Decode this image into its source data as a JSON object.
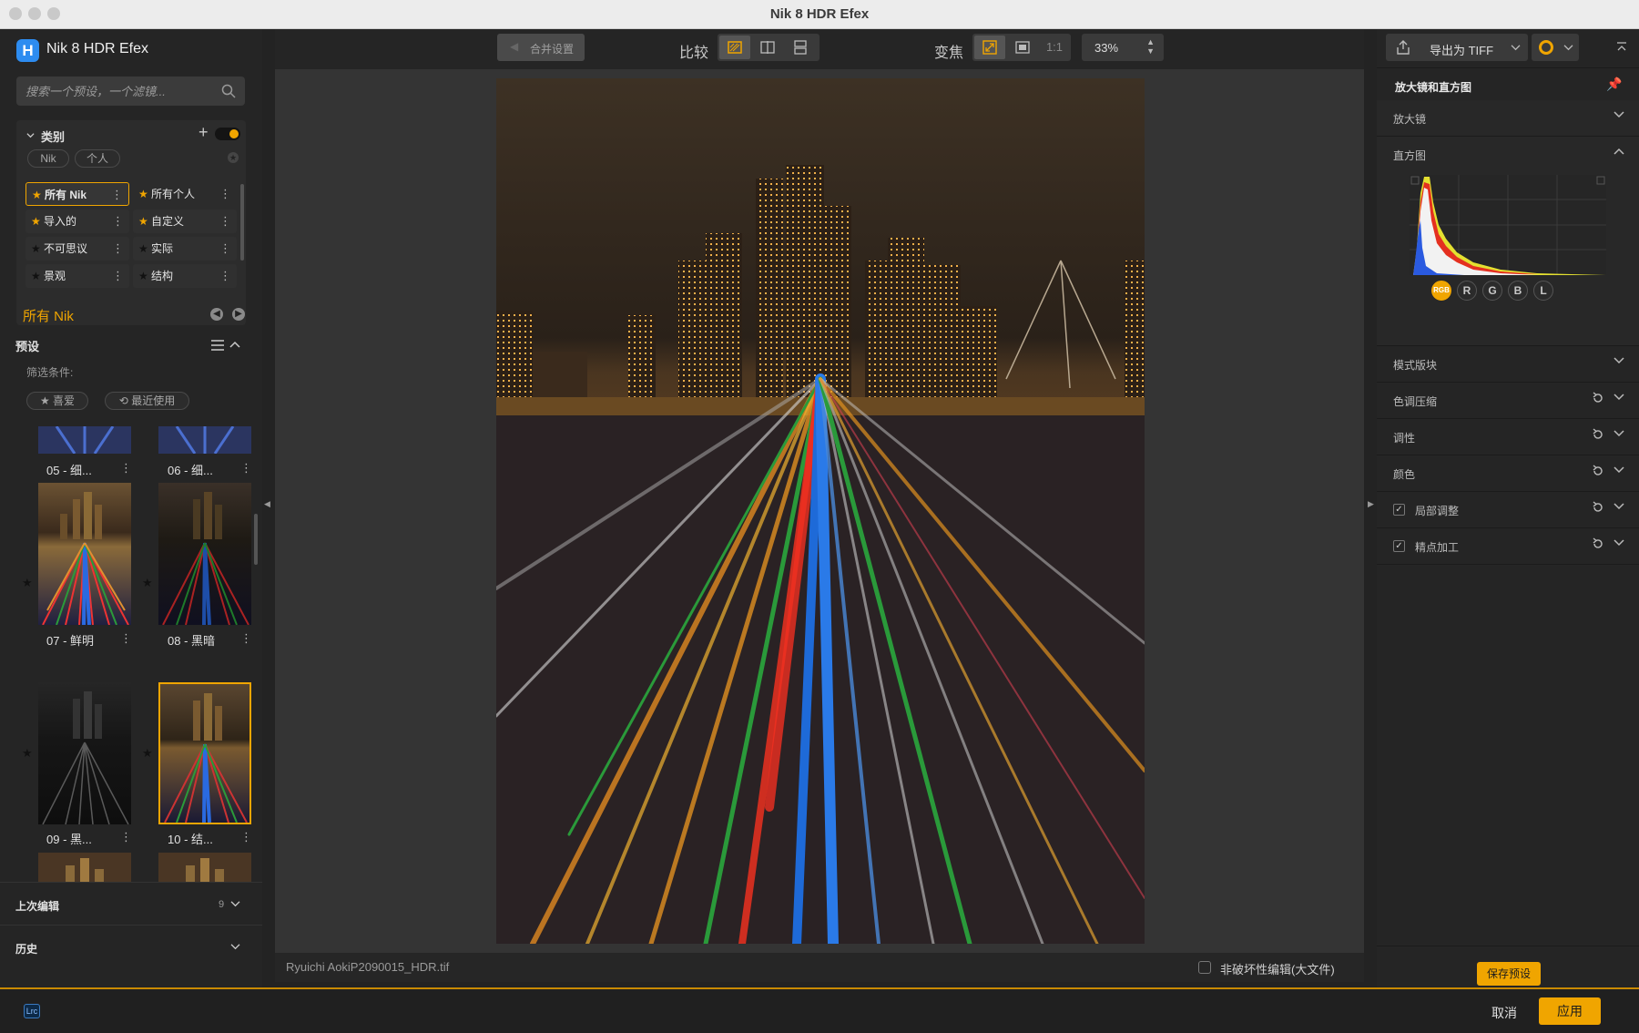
{
  "window": {
    "title": "Nik 8 HDR Efex"
  },
  "sidebar": {
    "app_name": "Nik 8 HDR Efex",
    "logo_letter": "H",
    "search_placeholder": "搜索一个预设，一个滤镜...",
    "category_title": "类别",
    "filter_pills": [
      "Nik",
      "个人"
    ],
    "categories": [
      {
        "label": "所有 Nik",
        "starred": true,
        "selected": true
      },
      {
        "label": "所有个人",
        "starred": true,
        "selected": false
      },
      {
        "label": "导入的",
        "starred": true,
        "selected": false
      },
      {
        "label": "自定义",
        "starred": true,
        "selected": false
      },
      {
        "label": "不可思议",
        "starred": false,
        "selected": false
      },
      {
        "label": "实际",
        "starred": false,
        "selected": false
      },
      {
        "label": "景观",
        "starred": false,
        "selected": false
      },
      {
        "label": "结构",
        "starred": false,
        "selected": false
      }
    ],
    "current_collection": "所有 Nik",
    "presets_title": "预设",
    "filter_conditions": "筛选条件:",
    "filter_buttons": [
      "喜爱",
      "最近使用"
    ],
    "presets": [
      {
        "label": "05 - 细..."
      },
      {
        "label": "06 - 细..."
      },
      {
        "label": "07 - 鲜明"
      },
      {
        "label": "08 - 黑暗"
      },
      {
        "label": "09 - 黑..."
      },
      {
        "label": "10 - 结..."
      }
    ],
    "last_edit": {
      "label": "上次编辑",
      "count": "9"
    },
    "history": "历史"
  },
  "toolbar": {
    "merge_label": "合并设置",
    "compare_label": "比较",
    "zoom_label": "变焦",
    "one_to_one": "1:1",
    "zoom_value": "33%"
  },
  "status": {
    "filename": "Ryuichi AokiP2090015_HDR.tif",
    "nondestructive": "非破坏性编辑(大文件)"
  },
  "right_panel": {
    "export_label": "导出为 TIFF",
    "loupe_title": "放大镜和直方图",
    "loupe": "放大镜",
    "histogram": "直方图",
    "channels": [
      "RGB",
      "R",
      "G",
      "B",
      "L"
    ],
    "sections": [
      {
        "label": "模式版块",
        "reset": false,
        "checkbox": false
      },
      {
        "label": "色调压缩",
        "reset": true,
        "checkbox": false
      },
      {
        "label": "调性",
        "reset": true,
        "checkbox": false
      },
      {
        "label": "颜色",
        "reset": true,
        "checkbox": false
      },
      {
        "label": "局部调整",
        "reset": true,
        "checkbox": true
      },
      {
        "label": "精点加工",
        "reset": true,
        "checkbox": true
      }
    ],
    "save_preset": "保存预设"
  },
  "footer": {
    "lrc_badge": "Lrc",
    "cancel": "取消",
    "apply": "应用"
  },
  "colors": {
    "accent": "#f0a500",
    "logo": "#2d8cf0"
  }
}
